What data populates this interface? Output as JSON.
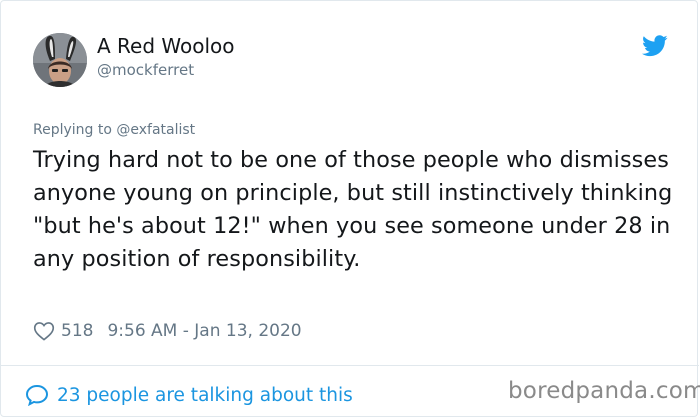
{
  "author": {
    "display_name": "A Red Wooloo",
    "handle": "@mockferret",
    "avatar_icon": "avatar-bunny-ears"
  },
  "reply": {
    "text": "Replying to @exfatalist"
  },
  "tweet": {
    "text": "Trying hard not to be one of those people who dismisses anyone young on principle, but still instinctively thinking \"but he's about 12!\" when you see someone under 28 in any position of responsibility."
  },
  "meta": {
    "likes": "518",
    "timestamp": "9:56 AM - Jan 13, 2020"
  },
  "footer": {
    "conversation": "23 people are talking about this"
  },
  "watermark": {
    "text": "boredpanda.com"
  },
  "colors": {
    "twitter_blue": "#1da1f2",
    "link_blue": "#1b95e0",
    "muted": "#657786",
    "text": "#14171a"
  },
  "icons": {
    "brand": "twitter-bird-icon",
    "like": "heart-icon",
    "conversation": "speech-bubble-icon"
  }
}
